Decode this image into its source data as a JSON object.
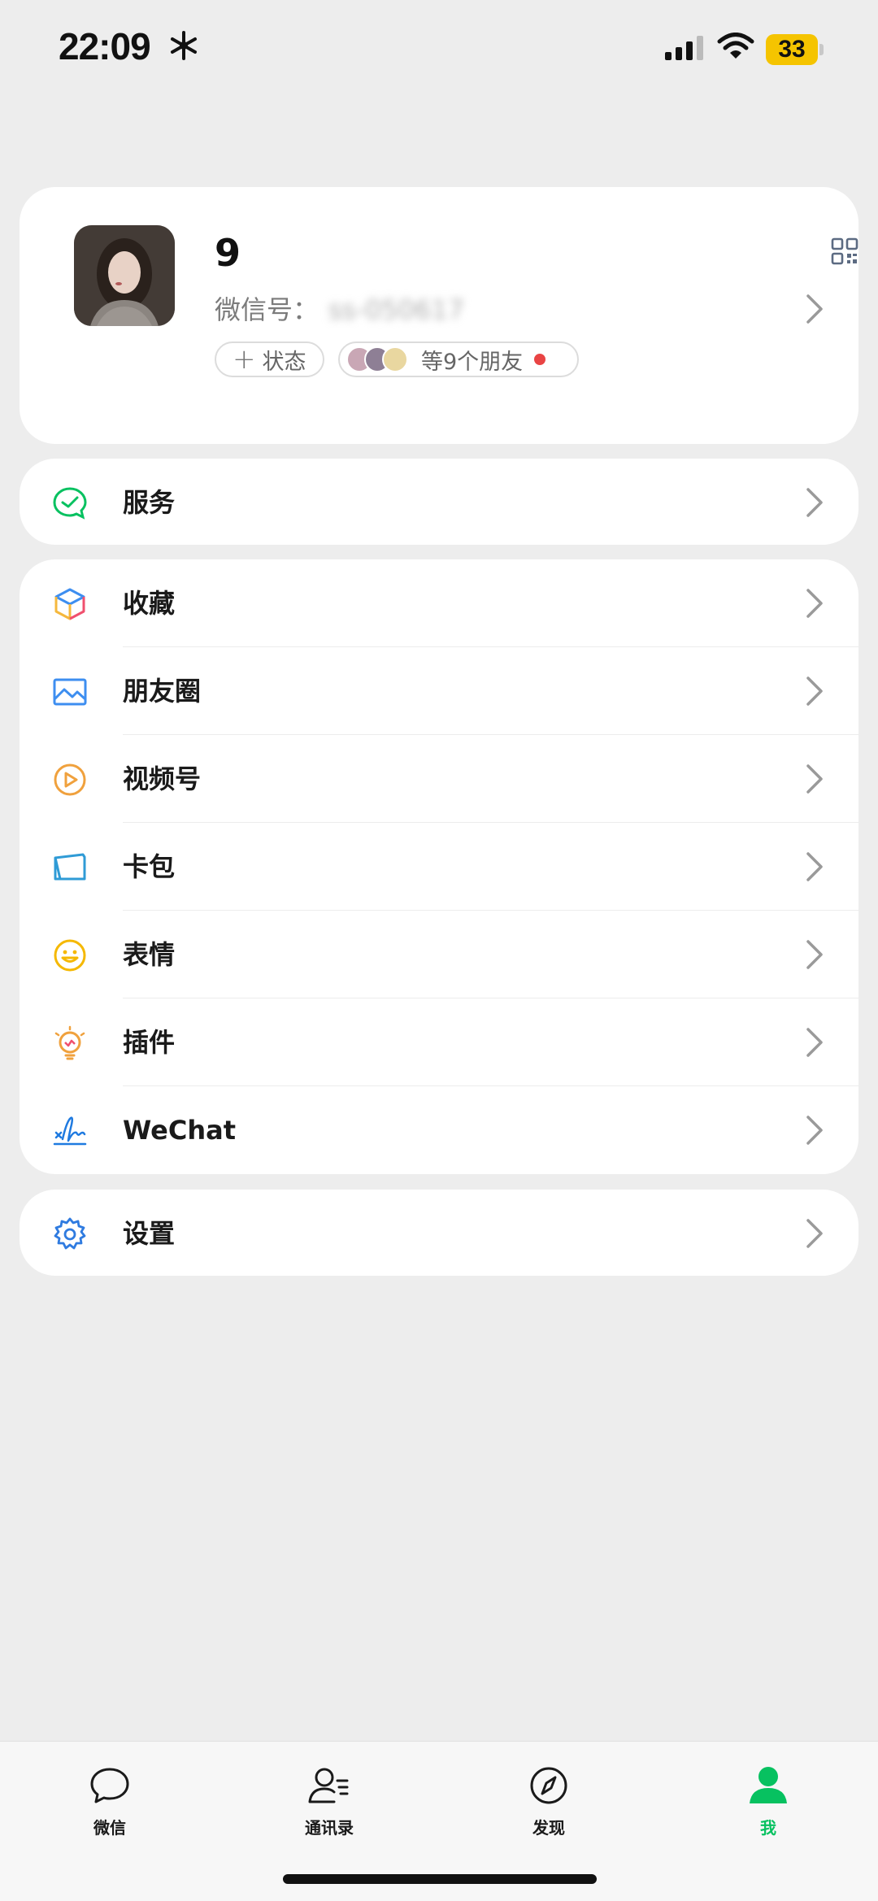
{
  "status_bar": {
    "time": "22:09",
    "battery": "33"
  },
  "profile": {
    "name": "9",
    "wechat_id_label": "微信号：",
    "wechat_id_value": "ss-050617",
    "status_button": "状态",
    "friends_text": "等9个朋友"
  },
  "menu": {
    "services": {
      "label": "服务",
      "icon": "services-icon"
    },
    "items": [
      {
        "label": "收藏",
        "icon": "favorites-cube-icon"
      },
      {
        "label": "朋友圈",
        "icon": "moments-photo-icon"
      },
      {
        "label": "视频号",
        "icon": "channels-play-icon"
      },
      {
        "label": "卡包",
        "icon": "card-wallet-icon"
      },
      {
        "label": "表情",
        "icon": "sticker-smile-icon"
      },
      {
        "label": "插件",
        "icon": "plugin-bulb-icon"
      },
      {
        "label": "WeChat",
        "icon": "wechat-signature-icon"
      }
    ],
    "settings": {
      "label": "设置",
      "icon": "gear-icon"
    }
  },
  "tabbar": {
    "tabs": [
      {
        "label": "微信",
        "icon": "chat-bubble-icon"
      },
      {
        "label": "通讯录",
        "icon": "contacts-icon"
      },
      {
        "label": "发现",
        "icon": "compass-icon"
      },
      {
        "label": "我",
        "icon": "person-icon",
        "active": true
      }
    ]
  },
  "colors": {
    "accent": "#07c160",
    "background": "#ededed",
    "card": "#ffffff",
    "battery": "#f5c400"
  }
}
